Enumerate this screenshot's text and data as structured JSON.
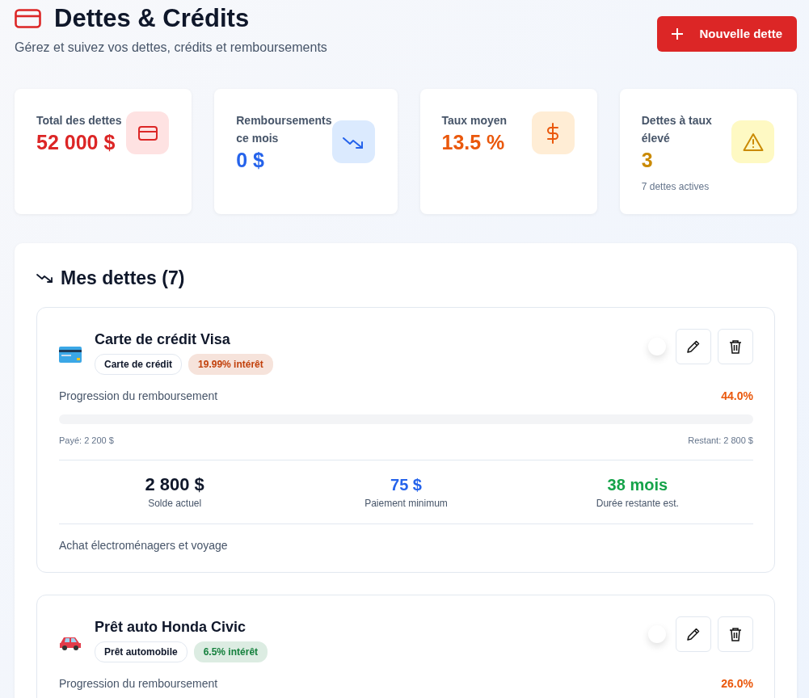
{
  "header": {
    "title": "Dettes & Crédits",
    "subtitle": "Gérez et suivez vos dettes, crédits et remboursements",
    "new_button": "Nouvelle dette"
  },
  "stats": [
    {
      "kind": "card",
      "label": "Total des dettes",
      "value": "52 000 $",
      "color": "#dc2626"
    },
    {
      "kind": "trend",
      "label": "Remboursements ce mois",
      "value": "0 $",
      "color": "#2563eb"
    },
    {
      "kind": "dollar",
      "label": "Taux moyen",
      "value": "13.5 %",
      "color": "#ea580c"
    },
    {
      "kind": "warning",
      "label": "Dettes à taux élevé",
      "value": "3",
      "note": "7 dettes actives",
      "color": "#ca8a04"
    }
  ],
  "debts_panel": {
    "title": "Mes dettes (7)",
    "debts": [
      {
        "kind": "card",
        "name": "Carte de crédit Visa",
        "type": "Carte de crédit",
        "rate": "19.99% intérêt",
        "color": "#c2410c",
        "progress_label": "Progression du remboursement",
        "percent": "44.0%",
        "level": 0,
        "paid": "Payé: 2 200 $",
        "remaining": "Restant: 2 800 $",
        "balance": "2 800 $",
        "balance_label": "Solde actuel",
        "minimum": "75 $",
        "minimum_label": "Paiement minimum",
        "duration": "38 mois",
        "duration_label": "Durée restante est.",
        "note": "Achat électroménagers et voyage"
      },
      {
        "kind": "car",
        "name": "Prêt auto Honda Civic",
        "type": "Prêt automobile",
        "rate": "6.5% intérêt",
        "color": "#15803d",
        "progress_label": "Progression du remboursement",
        "percent": "26.0%"
      }
    ]
  }
}
